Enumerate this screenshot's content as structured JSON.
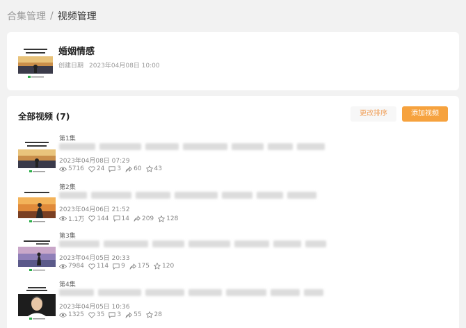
{
  "breadcrumb": {
    "parent": "合集管理",
    "separator": "/",
    "current": "视频管理"
  },
  "collection": {
    "title": "婚姻情感",
    "date_label": "创建日期",
    "date_value": "2023年04月08日 10:00"
  },
  "section": {
    "title": "全部视频 (7)",
    "sort_button": "更改排序",
    "add_button": "添加视频"
  },
  "videos": [
    {
      "episode": "第1集",
      "date": "2023年04月08日 07:29",
      "views": "5716",
      "likes": "24",
      "comments": "3",
      "shares": "60",
      "favorites": "43"
    },
    {
      "episode": "第2集",
      "date": "2023年04月06日 21:52",
      "views": "1.1万",
      "likes": "144",
      "comments": "14",
      "shares": "209",
      "favorites": "128"
    },
    {
      "episode": "第3集",
      "date": "2023年04月05日 20:33",
      "views": "7984",
      "likes": "114",
      "comments": "9",
      "shares": "175",
      "favorites": "120"
    },
    {
      "episode": "第4集",
      "date": "2023年04月05日 10:36",
      "views": "1325",
      "likes": "35",
      "comments": "3",
      "shares": "55",
      "favorites": "28"
    }
  ],
  "colors": {
    "accent": "#f6a23e",
    "sort_text": "#f0a05a",
    "background": "#f2f2f2"
  }
}
